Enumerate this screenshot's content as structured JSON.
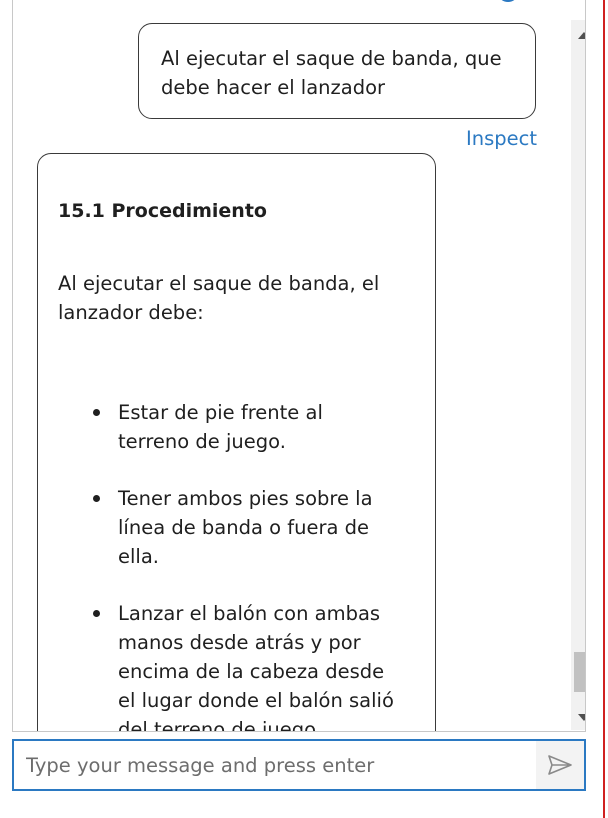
{
  "chat": {
    "user_message": "Al ejecutar el saque de banda, que debe hacer el lanzador",
    "inspect_label": "Inspect",
    "bot_message": {
      "heading": "15.1 Procedimiento",
      "paragraph": "Al ejecutar el saque de banda, el lanzador debe:",
      "items": [
        "Estar de pie frente al terreno de juego.",
        "Tener ambos pies sobre la línea de banda o fuera de ella.",
        "Lanzar el balón con ambas manos desde atrás y por encima de la cabeza desde el lugar donde el balón salió del terreno de juego."
      ]
    }
  },
  "composer": {
    "placeholder": "Type your message and press enter",
    "value": ""
  },
  "icons": {
    "send": "send-icon",
    "scroll_up": "chevron-up-icon",
    "scroll_down": "chevron-down-icon"
  },
  "colors": {
    "accent": "#2b79c2",
    "border": "#3a3a3a",
    "edge_line": "#d02020"
  }
}
